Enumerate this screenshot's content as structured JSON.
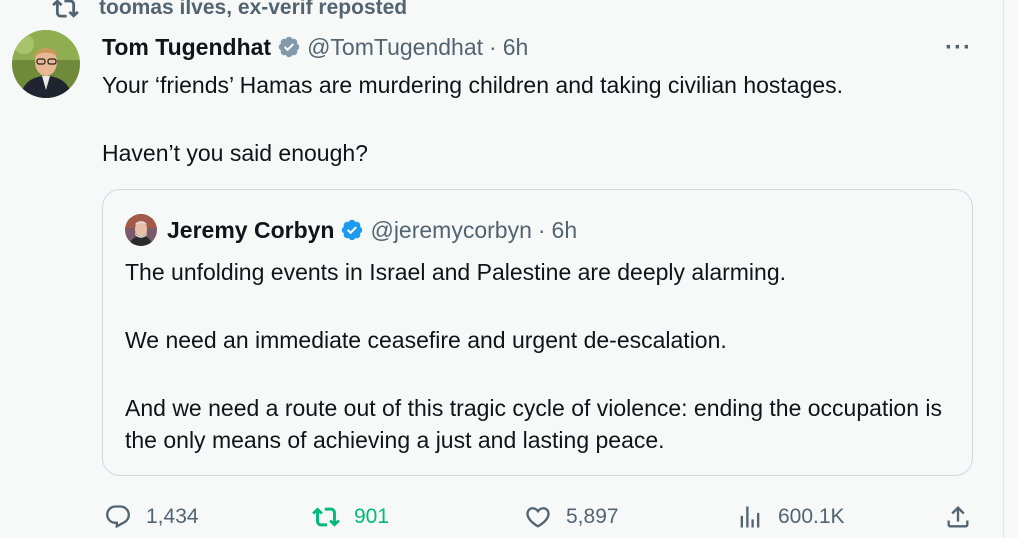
{
  "repost": {
    "text": "toomas ilves, ex-verif reposted",
    "icon": "repost-icon"
  },
  "tweet": {
    "author_name": "Tom Tugendhat",
    "handle": "@TomTugendhat",
    "separator": "·",
    "time": "6h",
    "more": "···",
    "text_line1": "Your ‘friends’ Hamas are murdering children and taking civilian hostages.",
    "text_line2": "Haven’t you said enough?"
  },
  "quoted": {
    "author_name": "Jeremy Corbyn",
    "handle": "@jeremycorbyn",
    "separator": "·",
    "time": "6h",
    "para1": "The unfolding events in Israel and Palestine are deeply alarming.",
    "para2": "We need an immediate ceasefire and urgent de-escalation.",
    "para3": "And we need a route out of this tragic cycle of violence: ending the occupation is the only means of achieving a just and lasting peace."
  },
  "actions": {
    "replies": "1,434",
    "reposts": "901",
    "likes": "5,897",
    "views": "600.1K"
  },
  "colors": {
    "background": "#f7f9f9",
    "muted": "#536471",
    "verified": "#1d9bf0",
    "repost_active": "#00ba7c",
    "border": "#cfd9de"
  }
}
